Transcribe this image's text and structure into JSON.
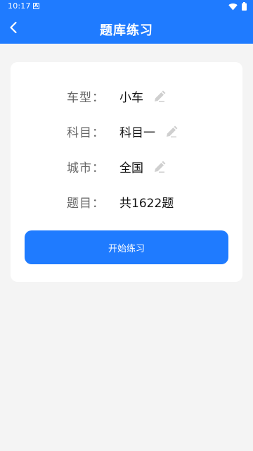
{
  "status_bar": {
    "time": "10:17",
    "notification_icon": "a-notification-icon",
    "wifi_icon": "wifi-icon",
    "battery_icon": "battery-icon"
  },
  "header": {
    "title": "题库练习",
    "back_icon": "chevron-left-icon"
  },
  "info": {
    "car_type": {
      "label": "车型：",
      "value": "小车"
    },
    "subject": {
      "label": "科目：",
      "value": "科目一"
    },
    "city": {
      "label": "城市：",
      "value": "全国"
    },
    "questions": {
      "label": "题目：",
      "value": "共1622题"
    }
  },
  "start_button_label": "开始练习",
  "colors": {
    "primary": "#1f7bff",
    "background": "#f4f4f4",
    "card": "#ffffff",
    "label": "#666666",
    "value": "#111111",
    "edit_icon": "#cfcfcf"
  }
}
